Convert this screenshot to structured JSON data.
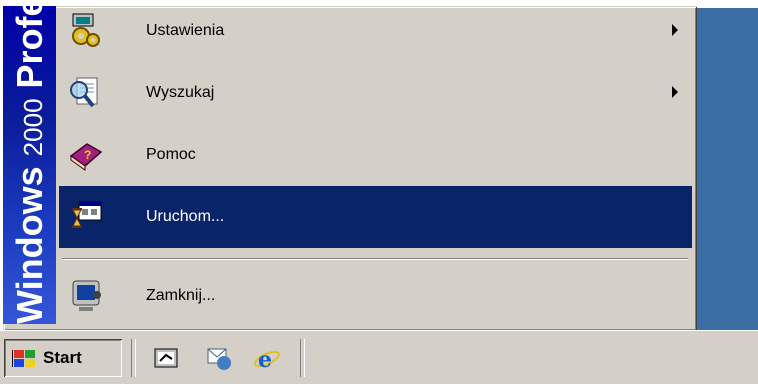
{
  "banner": {
    "part1": "Windows",
    "part2": "2000",
    "part3": "Profe"
  },
  "menu": {
    "items": [
      {
        "label": "Ustawienia",
        "icon": "settings-icon",
        "submenu": true
      },
      {
        "label": "Wyszukaj",
        "icon": "search-icon",
        "submenu": true
      },
      {
        "label": "Pomoc",
        "icon": "help-book-icon",
        "submenu": false
      },
      {
        "label": "Uruchom...",
        "icon": "run-icon",
        "submenu": false,
        "selected": true
      },
      {
        "label": "Zamknij...",
        "icon": "shutdown-icon",
        "submenu": false
      }
    ]
  },
  "taskbar": {
    "start_label": "Start",
    "quick_launch": [
      "show-desktop-icon",
      "outlook-express-icon",
      "internet-explorer-icon"
    ]
  },
  "colors": {
    "menu_bg": "#d4d0c8",
    "selection": "#0a246a",
    "desktop": "#3a6ea5",
    "banner_top": "#0000a8",
    "banner_bottom": "#3556d8"
  }
}
